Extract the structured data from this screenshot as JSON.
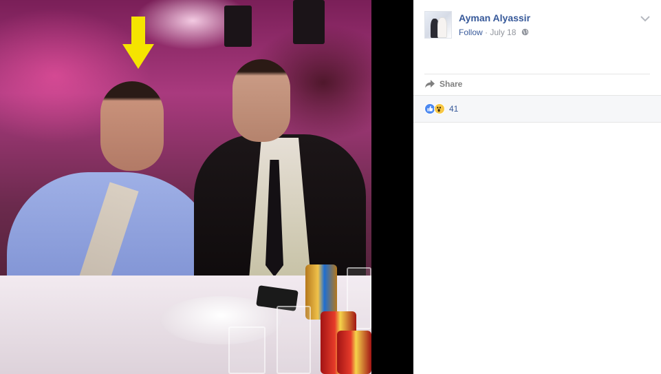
{
  "post": {
    "author_name": "Ayman Alyassir",
    "follow_label": "Follow",
    "separator": "·",
    "date": "July 18",
    "privacy_icon": "globe-icon",
    "options_icon": "chevron-down-icon"
  },
  "actions": {
    "share_label": "Share",
    "share_icon": "share-arrow-icon"
  },
  "reactions": {
    "types": [
      "like",
      "wow"
    ],
    "count": "41"
  },
  "photo": {
    "annotation_icon": "yellow-down-arrow-icon",
    "annotation_color": "#f5e400"
  },
  "colors": {
    "link_blue": "#365899",
    "muted_gray": "#90949c",
    "like_blue": "#4b88f0",
    "wow_yellow": "#f7c744",
    "backdrop": "#000000"
  }
}
